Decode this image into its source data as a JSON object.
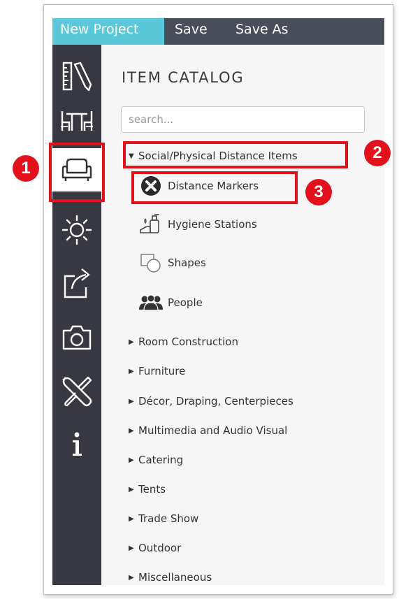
{
  "toolbar": {
    "new_project": "New Project",
    "save": "Save",
    "save_as": "Save As"
  },
  "sidebar": {
    "items": [
      {
        "icon": "ruler-pencil-icon",
        "active": false
      },
      {
        "icon": "table-chairs-icon",
        "active": false
      },
      {
        "icon": "armchair-icon",
        "active": true
      },
      {
        "icon": "light-sun-icon",
        "active": false
      },
      {
        "icon": "export-icon",
        "active": false
      },
      {
        "icon": "camera-icon",
        "active": false
      },
      {
        "icon": "tools-icon",
        "active": false
      },
      {
        "icon": "info-icon",
        "active": false
      }
    ]
  },
  "catalog": {
    "title": "ITEM CATALOG",
    "search_placeholder": "search...",
    "expanded_category": "Social/Physical Distance Items",
    "sub_items": [
      {
        "label": "Distance Markers",
        "icon": "x-circle-icon"
      },
      {
        "label": "Hygiene Stations",
        "icon": "hand-sanitizer-icon"
      },
      {
        "label": "Shapes",
        "icon": "shapes-icon"
      },
      {
        "label": "People",
        "icon": "people-icon"
      }
    ],
    "categories": [
      "Room Construction",
      "Furniture",
      "Décor, Draping, Centerpieces",
      "Multimedia and Audio Visual",
      "Catering",
      "Tents",
      "Trade Show",
      "Outdoor",
      "Miscellaneous"
    ]
  },
  "annotations": {
    "badges": [
      "1",
      "2",
      "3"
    ],
    "color": "#e3111b"
  },
  "colors": {
    "accent": "#5ac8d8",
    "toolbar_bg": "#4a4d5a",
    "sidebar_bg": "#373841",
    "panel_bg": "#f6f6f6"
  }
}
